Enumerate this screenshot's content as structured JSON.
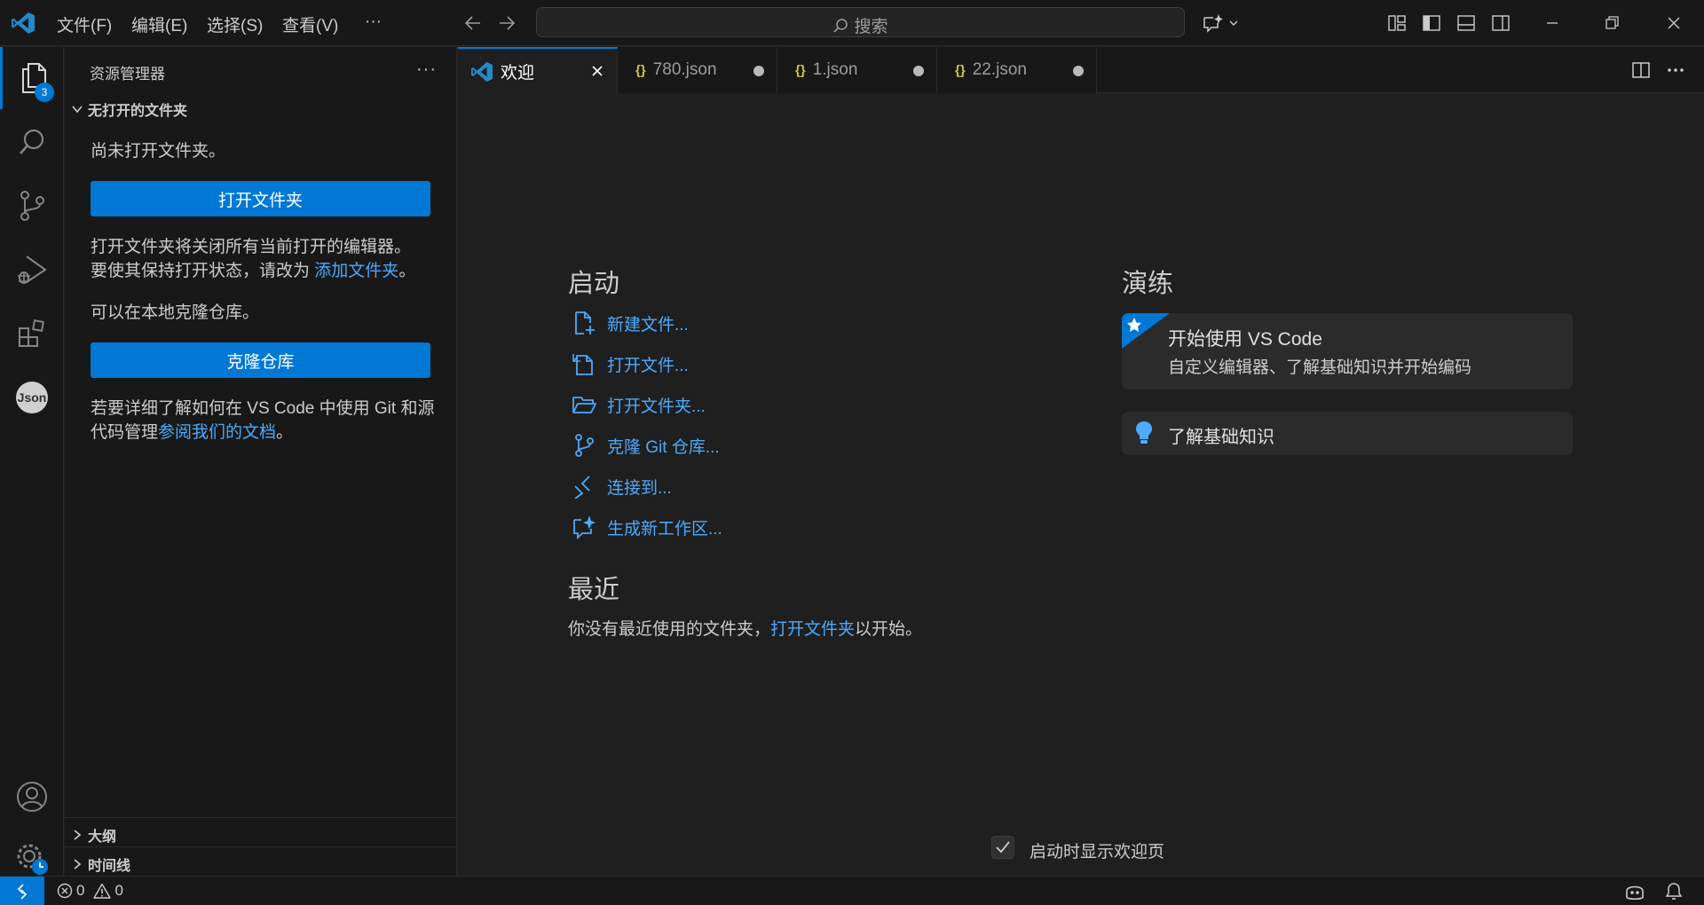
{
  "titlebar": {
    "menus": [
      "文件(F)",
      "编辑(E)",
      "选择(S)",
      "查看(V)",
      "···"
    ],
    "search_placeholder": "搜索"
  },
  "activity": {
    "explorer_badge": "3",
    "json_label": "Json"
  },
  "sidebar": {
    "title": "资源管理器",
    "more": "···",
    "section_title": "无打开的文件夹",
    "no_folder_text": "尚未打开文件夹。",
    "open_folder_button": "打开文件夹",
    "info_line1": "打开文件夹将关闭所有当前打开的编辑器。",
    "info_line2_prefix": "要使其保持打开状态，请改为",
    "add_folder_link": "添加文件夹",
    "info_line2_suffix": "。",
    "clone_text": "可以在本地克隆仓库。",
    "clone_button": "克隆仓库",
    "docs_prefix": "若要详细了解如何在 VS Code 中使用 Git 和源代码管理",
    "docs_link": "参阅我们的文档",
    "docs_suffix": "。",
    "outline": "大纲",
    "timeline": "时间线"
  },
  "tabs": [
    {
      "label": "欢迎",
      "active": true
    },
    {
      "label": "780.json",
      "icon": "{}"
    },
    {
      "label": "1.json",
      "icon": "{}"
    },
    {
      "label": "22.json",
      "icon": "{}"
    }
  ],
  "welcome": {
    "start_title": "启动",
    "start_items": [
      "新建文件...",
      "打开文件...",
      "打开文件夹...",
      "克隆 Git 仓库...",
      "连接到...",
      "生成新工作区..."
    ],
    "recent_title": "最近",
    "recent_prefix": "你没有最近使用的文件夹，",
    "recent_link": "打开文件夹",
    "recent_suffix": "以开始。",
    "walkthrough_title": "演练",
    "card1_title": "开始使用 VS Code",
    "card1_desc": "自定义编辑器、了解基础知识并开始编码",
    "card2_title": "了解基础知识",
    "show_on_startup": "启动时显示欢迎页"
  },
  "statusbar": {
    "errors": "0",
    "warnings": "0"
  },
  "colors": {
    "accent": "#0078d4",
    "link": "#4daafc"
  }
}
